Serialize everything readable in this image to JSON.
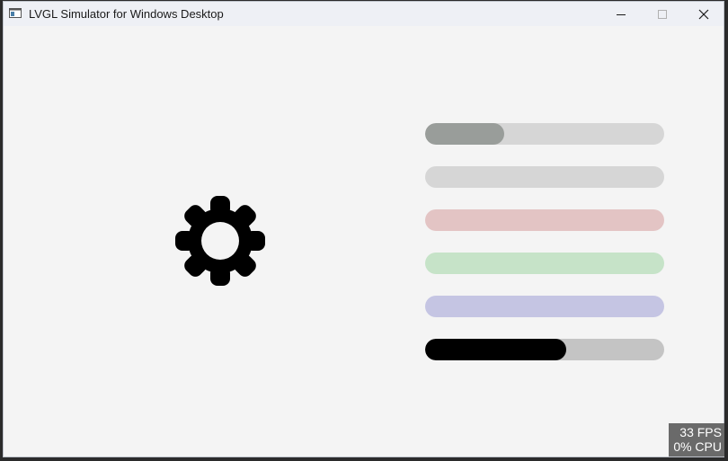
{
  "window": {
    "title": "LVGL Simulator for Windows Desktop",
    "icons": {
      "app": "app-window-icon",
      "minimize": "minimize-icon",
      "maximize": "maximize-icon",
      "close": "close-icon"
    }
  },
  "content": {
    "icon": "gear-icon",
    "bars": [
      {
        "fill_fraction": 0.33,
        "track_color": "#d6d6d6",
        "fill_color": "#999d9a"
      },
      {
        "fill_fraction": 0.0,
        "track_color": "#d6d6d6",
        "fill_color": "#999d9a"
      },
      {
        "fill_fraction": 0.0,
        "track_color": "#e3c4c4",
        "fill_color": "#e3c4c4"
      },
      {
        "fill_fraction": 0.0,
        "track_color": "#c6e3c8",
        "fill_color": "#c6e3c8"
      },
      {
        "fill_fraction": 0.0,
        "track_color": "#c5c5e3",
        "fill_color": "#c5c5e3"
      },
      {
        "fill_fraction": 0.59,
        "track_color": "#c4c4c4",
        "fill_color": "#000000"
      }
    ]
  },
  "perf_monitor": {
    "fps": "33 FPS",
    "cpu": "0% CPU"
  }
}
